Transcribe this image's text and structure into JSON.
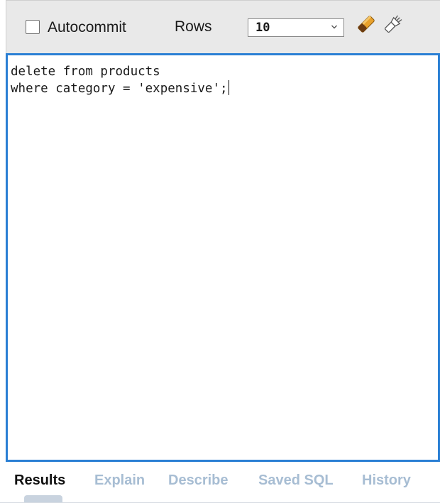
{
  "toolbar": {
    "autocommit_label": "Autocommit",
    "autocommit_checked": false,
    "rows_label": "Rows",
    "rows_value": "10",
    "clear_icon": "eraser-icon",
    "format_icon": "brush-icon"
  },
  "editor": {
    "line1": "delete from products",
    "line2": "where category = 'expensive';"
  },
  "tabs": [
    {
      "label": "Results",
      "active": true
    },
    {
      "label": "Explain",
      "active": false
    },
    {
      "label": "Describe",
      "active": false
    },
    {
      "label": "Saved SQL",
      "active": false
    },
    {
      "label": "History",
      "active": false
    }
  ],
  "colors": {
    "editor_border": "#2a7fd4",
    "tab_inactive": "#a7bdd3",
    "toolbar_bg": "#e9e9e9"
  }
}
